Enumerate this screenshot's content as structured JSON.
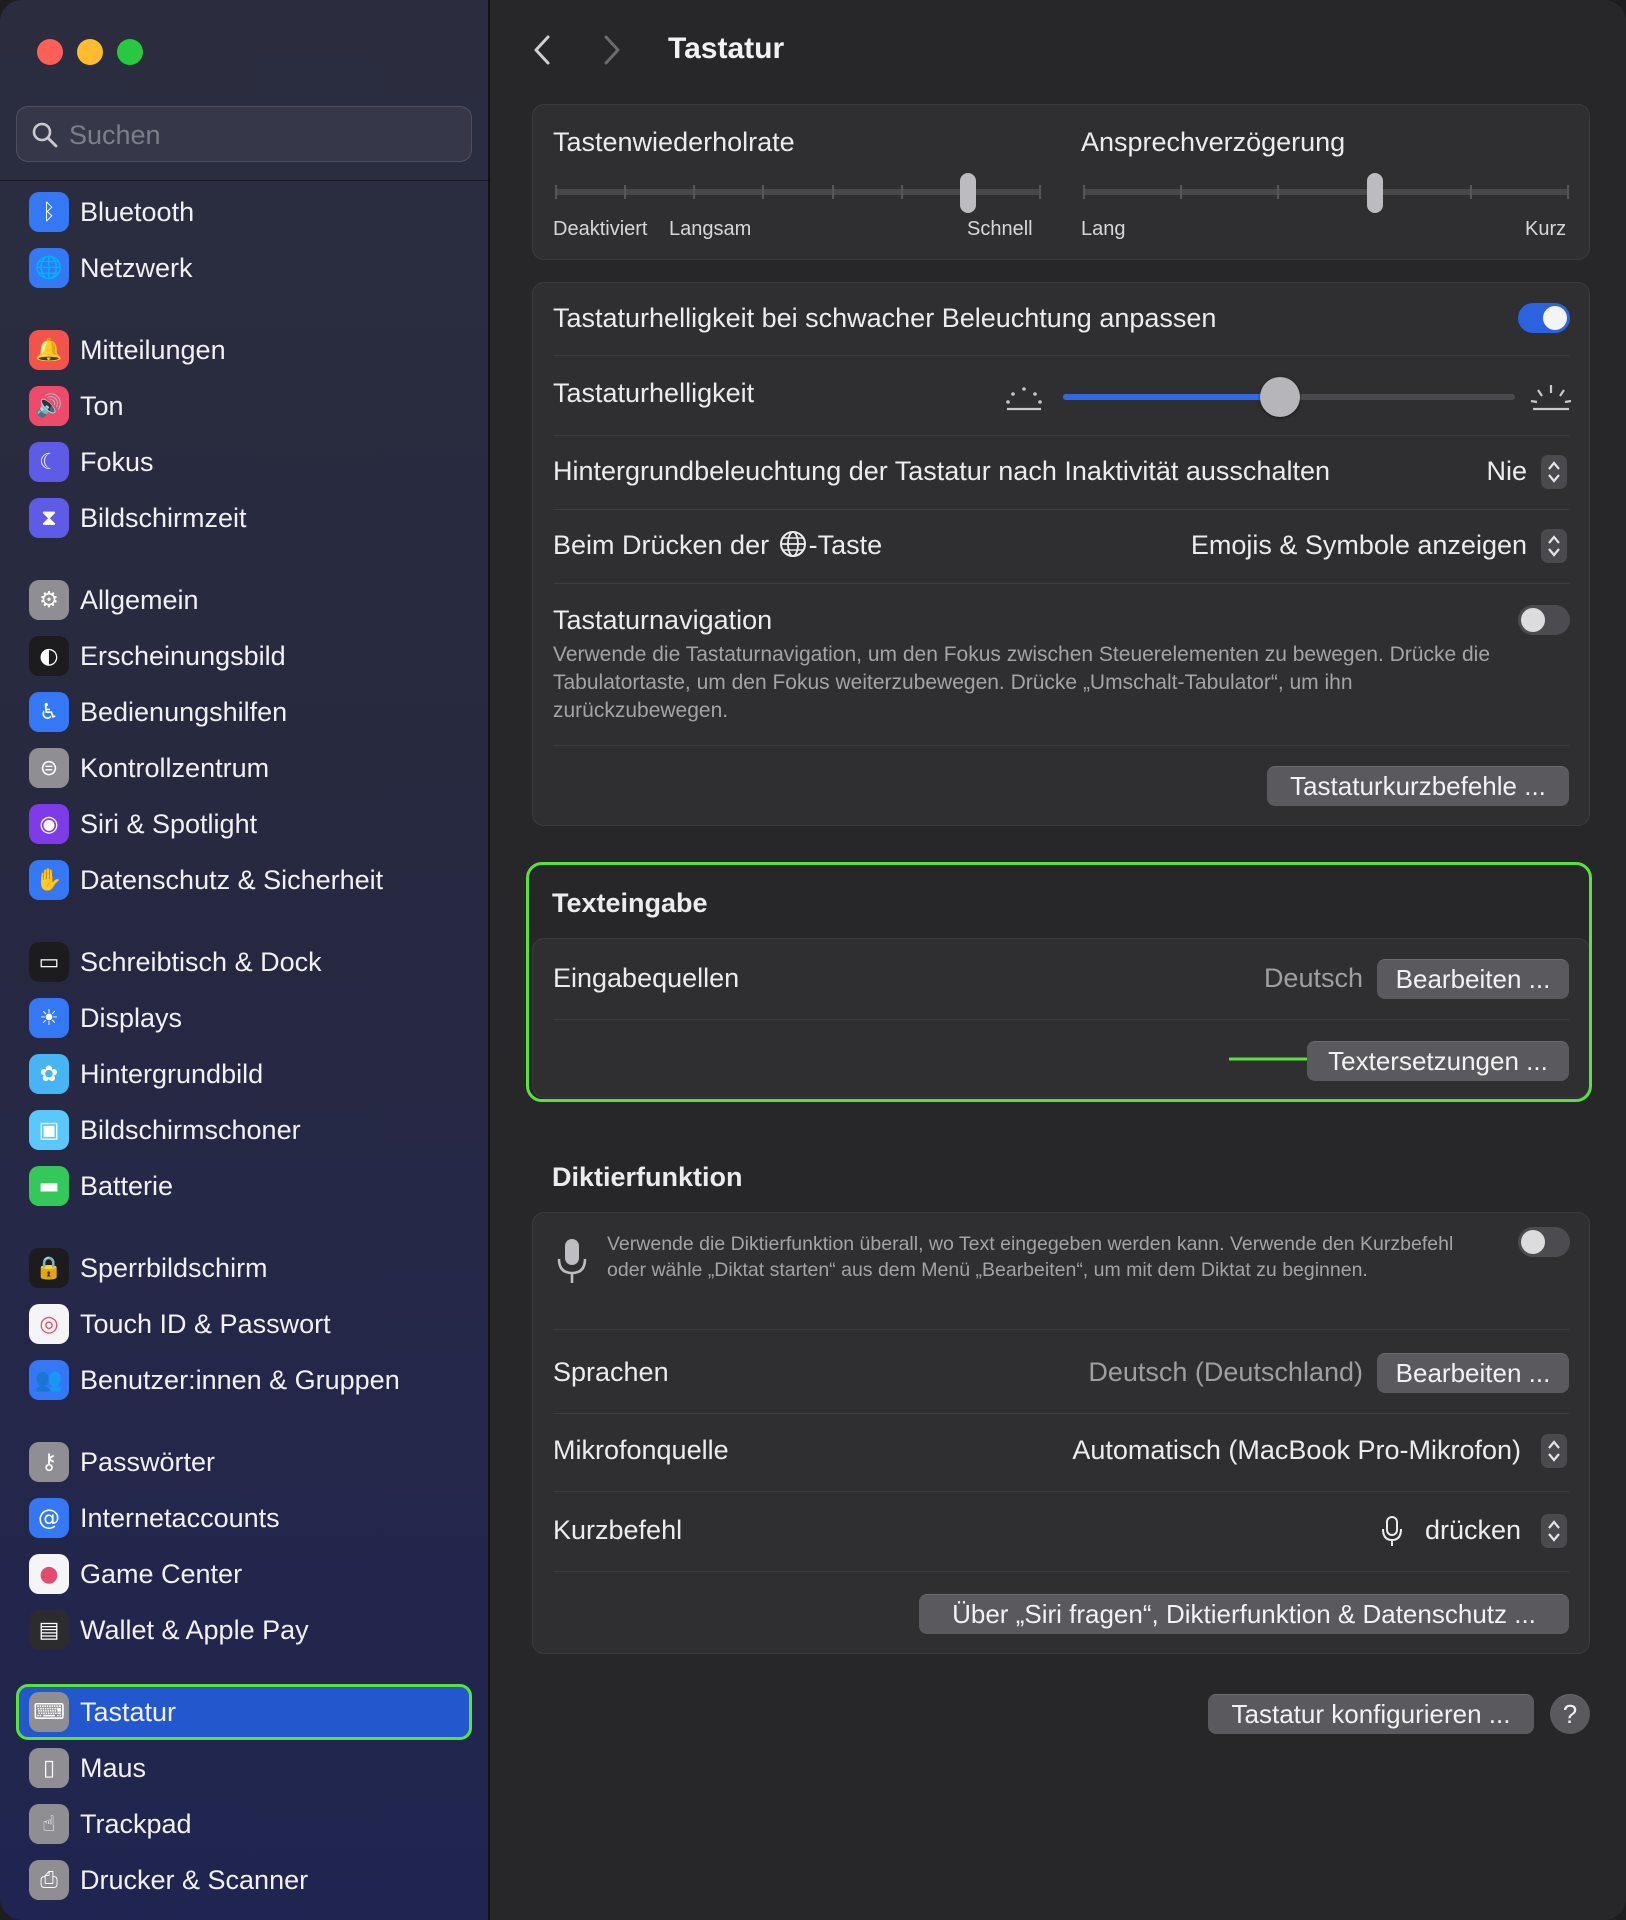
{
  "search": {
    "placeholder": "Suchen"
  },
  "sidebar": {
    "items": [
      {
        "label": "Bluetooth",
        "icon": "bluetooth-icon",
        "color": "#3478f6",
        "glyph": "ᛒ",
        "active": false
      },
      {
        "label": "Netzwerk",
        "icon": "globe-icon",
        "color": "#3478f6",
        "glyph": "🌐",
        "active": false
      },
      {
        "label": "Mitteilungen",
        "icon": "bell-icon",
        "color": "#f2544c",
        "glyph": "🔔",
        "active": false
      },
      {
        "label": "Ton",
        "icon": "speaker-icon",
        "color": "#f04a6a",
        "glyph": "🔊",
        "active": false
      },
      {
        "label": "Fokus",
        "icon": "moon-icon",
        "color": "#5e5ce6",
        "glyph": "☾",
        "active": false
      },
      {
        "label": "Bildschirmzeit",
        "icon": "hourglass-icon",
        "color": "#5e5ce6",
        "glyph": "⧗",
        "active": false
      },
      {
        "label": "Allgemein",
        "icon": "gear-icon",
        "color": "#8e8e93",
        "glyph": "⚙",
        "active": false
      },
      {
        "label": "Erscheinungsbild",
        "icon": "appearance-icon",
        "color": "#1c1c1e",
        "glyph": "◐",
        "active": false
      },
      {
        "label": "Bedienungshilfen",
        "icon": "accessibility-icon",
        "color": "#3478f6",
        "glyph": "♿",
        "active": false
      },
      {
        "label": "Kontrollzentrum",
        "icon": "control-center-icon",
        "color": "#8e8e93",
        "glyph": "⊜",
        "active": false
      },
      {
        "label": "Siri & Spotlight",
        "icon": "siri-icon",
        "color": "#7d3ce8",
        "glyph": "◉",
        "active": false
      },
      {
        "label": "Datenschutz & Sicherheit",
        "icon": "hand-icon",
        "color": "#3478f6",
        "glyph": "✋",
        "active": false
      },
      {
        "label": "Schreibtisch & Dock",
        "icon": "dock-icon",
        "color": "#1c1c1e",
        "glyph": "▭",
        "active": false
      },
      {
        "label": "Displays",
        "icon": "sun-icon",
        "color": "#3478f6",
        "glyph": "☀",
        "active": false
      },
      {
        "label": "Hintergrundbild",
        "icon": "flower-icon",
        "color": "#47b4f4",
        "glyph": "✿",
        "active": false
      },
      {
        "label": "Bildschirmschoner",
        "icon": "screensaver-icon",
        "color": "#5ac8fa",
        "glyph": "▣",
        "active": false
      },
      {
        "label": "Batterie",
        "icon": "battery-icon",
        "color": "#34c759",
        "glyph": "▬",
        "active": false
      },
      {
        "label": "Sperrbildschirm",
        "icon": "lock-icon",
        "color": "#1c1c1e",
        "glyph": "🔒",
        "active": false
      },
      {
        "label": "Touch ID & Passwort",
        "icon": "fingerprint-icon",
        "color": "#f5f5f7",
        "glyph": "◎",
        "active": false
      },
      {
        "label": "Benutzer:innen & Gruppen",
        "icon": "users-icon",
        "color": "#3478f6",
        "glyph": "👥",
        "active": false
      },
      {
        "label": "Passwörter",
        "icon": "key-icon",
        "color": "#8e8e93",
        "glyph": "⚷",
        "active": false
      },
      {
        "label": "Internetaccounts",
        "icon": "at-icon",
        "color": "#3478f6",
        "glyph": "@",
        "active": false
      },
      {
        "label": "Game Center",
        "icon": "game-center-icon",
        "color": "#f5f5f7",
        "glyph": "●",
        "active": false
      },
      {
        "label": "Wallet & Apple Pay",
        "icon": "wallet-icon",
        "color": "#2c2c2e",
        "glyph": "▤",
        "active": false
      },
      {
        "label": "Tastatur",
        "icon": "keyboard-icon",
        "color": "#8e8e93",
        "glyph": "⌨",
        "active": true
      },
      {
        "label": "Maus",
        "icon": "mouse-icon",
        "color": "#8e8e93",
        "glyph": "▯",
        "active": false
      },
      {
        "label": "Trackpad",
        "icon": "trackpad-icon",
        "color": "#8e8e93",
        "glyph": "☝",
        "active": false
      },
      {
        "label": "Drucker & Scanner",
        "icon": "printer-icon",
        "color": "#8e8e93",
        "glyph": "⎙",
        "active": false
      }
    ]
  },
  "header": {
    "title": "Tastatur"
  },
  "repeat": {
    "rate_label": "Tastenwiederholrate",
    "rate_left": "Deaktiviert",
    "rate_mid": "Langsam",
    "rate_right": "Schnell",
    "rate_level": 0.85,
    "delay_label": "Ansprechverzögerung",
    "delay_left": "Lang",
    "delay_right": "Kurz",
    "delay_level": 0.6
  },
  "brightness": {
    "auto_label": "Tastaturhelligkeit bei schwacher Beleuchtung anpassen",
    "auto_on": true,
    "level_label": "Tastaturhelligkeit",
    "level": 0.48,
    "backlight_label": "Hintergrundbeleuchtung der Tastatur nach Inaktivität ausschalten",
    "backlight_value": "Nie",
    "globe_label_pre": "Beim Drücken der",
    "globe_label_post": "-Taste",
    "globe_value": "Emojis & Symbole anzeigen",
    "nav_label": "Tastaturnavigation",
    "nav_desc": "Verwende die Tastaturnavigation, um den Fokus zwischen Steuerelementen zu bewegen. Drücke die Tabulatortaste, um den Fokus weiterzubewegen. Drücke „Umschalt-Tabulator“, um ihn zurückzubewegen.",
    "nav_on": false,
    "shortcuts_button": "Tastaturkurzbefehle ..."
  },
  "text_input": {
    "title": "Texteingabe",
    "sources_label": "Eingabequellen",
    "sources_value": "Deutsch",
    "edit_button": "Bearbeiten ...",
    "replacements_button": "Textersetzungen ..."
  },
  "dictation": {
    "title": "Diktierfunktion",
    "desc": "Verwende die Diktierfunktion überall, wo Text eingegeben werden kann. Verwende den Kurzbefehl oder wähle „Diktat starten“ aus dem Menü „Bearbeiten“, um mit dem Diktat zu beginnen.",
    "on": false,
    "languages_label": "Sprachen",
    "languages_value": "Deutsch (Deutschland)",
    "languages_button": "Bearbeiten ...",
    "mic_label": "Mikrofonquelle",
    "mic_value": "Automatisch (MacBook Pro-Mikrofon)",
    "shortcut_label": "Kurzbefehl",
    "shortcut_value": "drücken",
    "privacy_button": "Über „Siri fragen“, Diktierfunktion & Datenschutz ..."
  },
  "footer": {
    "configure_button": "Tastatur konfigurieren ...",
    "help_button": "?"
  },
  "colors": {
    "accent": "#2357cd",
    "highlight": "#58e23b",
    "toggle_on": "#2a62e0"
  }
}
